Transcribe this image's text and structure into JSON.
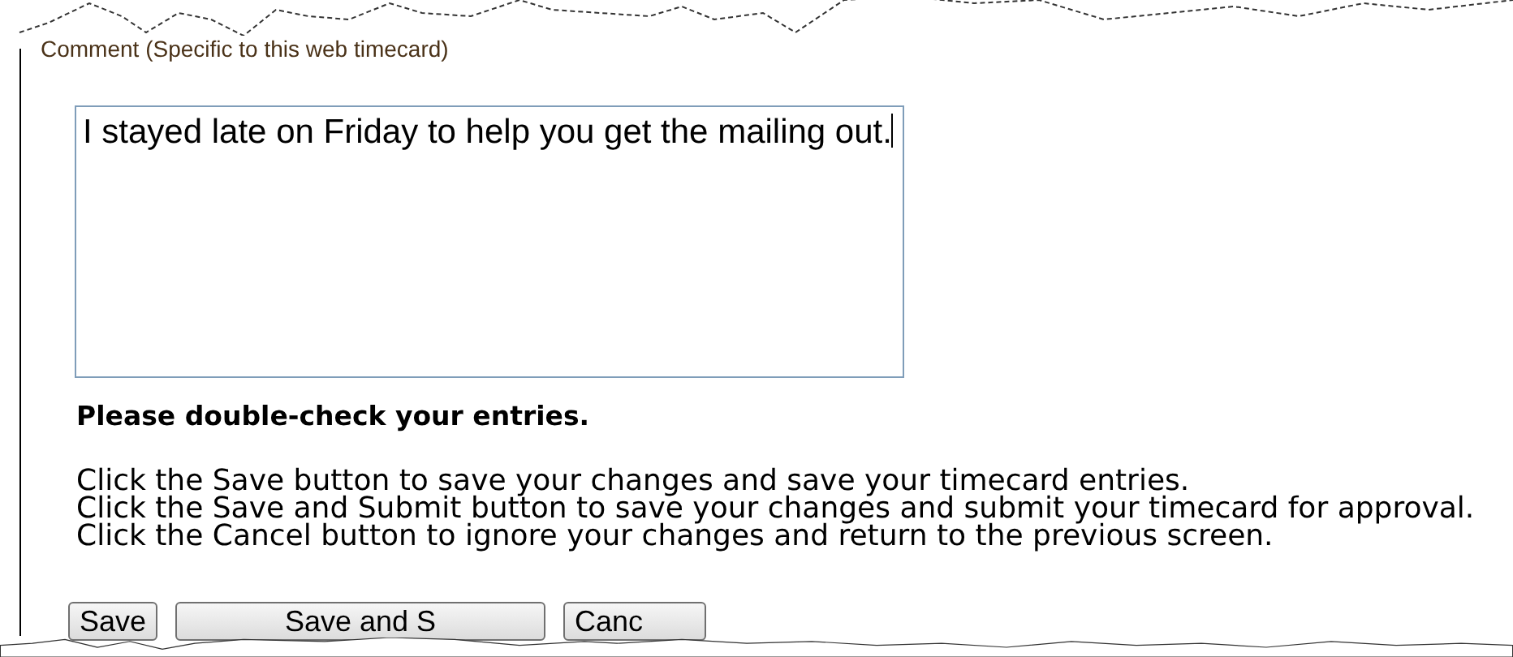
{
  "comment": {
    "label": "Comment (Specific to this web timecard)",
    "value": "I stayed late on Friday to help you get the mailing out."
  },
  "notice": "Please double-check your entries.",
  "instructions": [
    "Click the Save button to save your changes and save your timecard entries.",
    "Click the Save and Submit button to save your changes and submit your timecard for approval.",
    "Click the Cancel button to ignore your changes and return to the previous screen."
  ],
  "buttons": [
    "Save",
    "Save and S",
    "Canc"
  ]
}
